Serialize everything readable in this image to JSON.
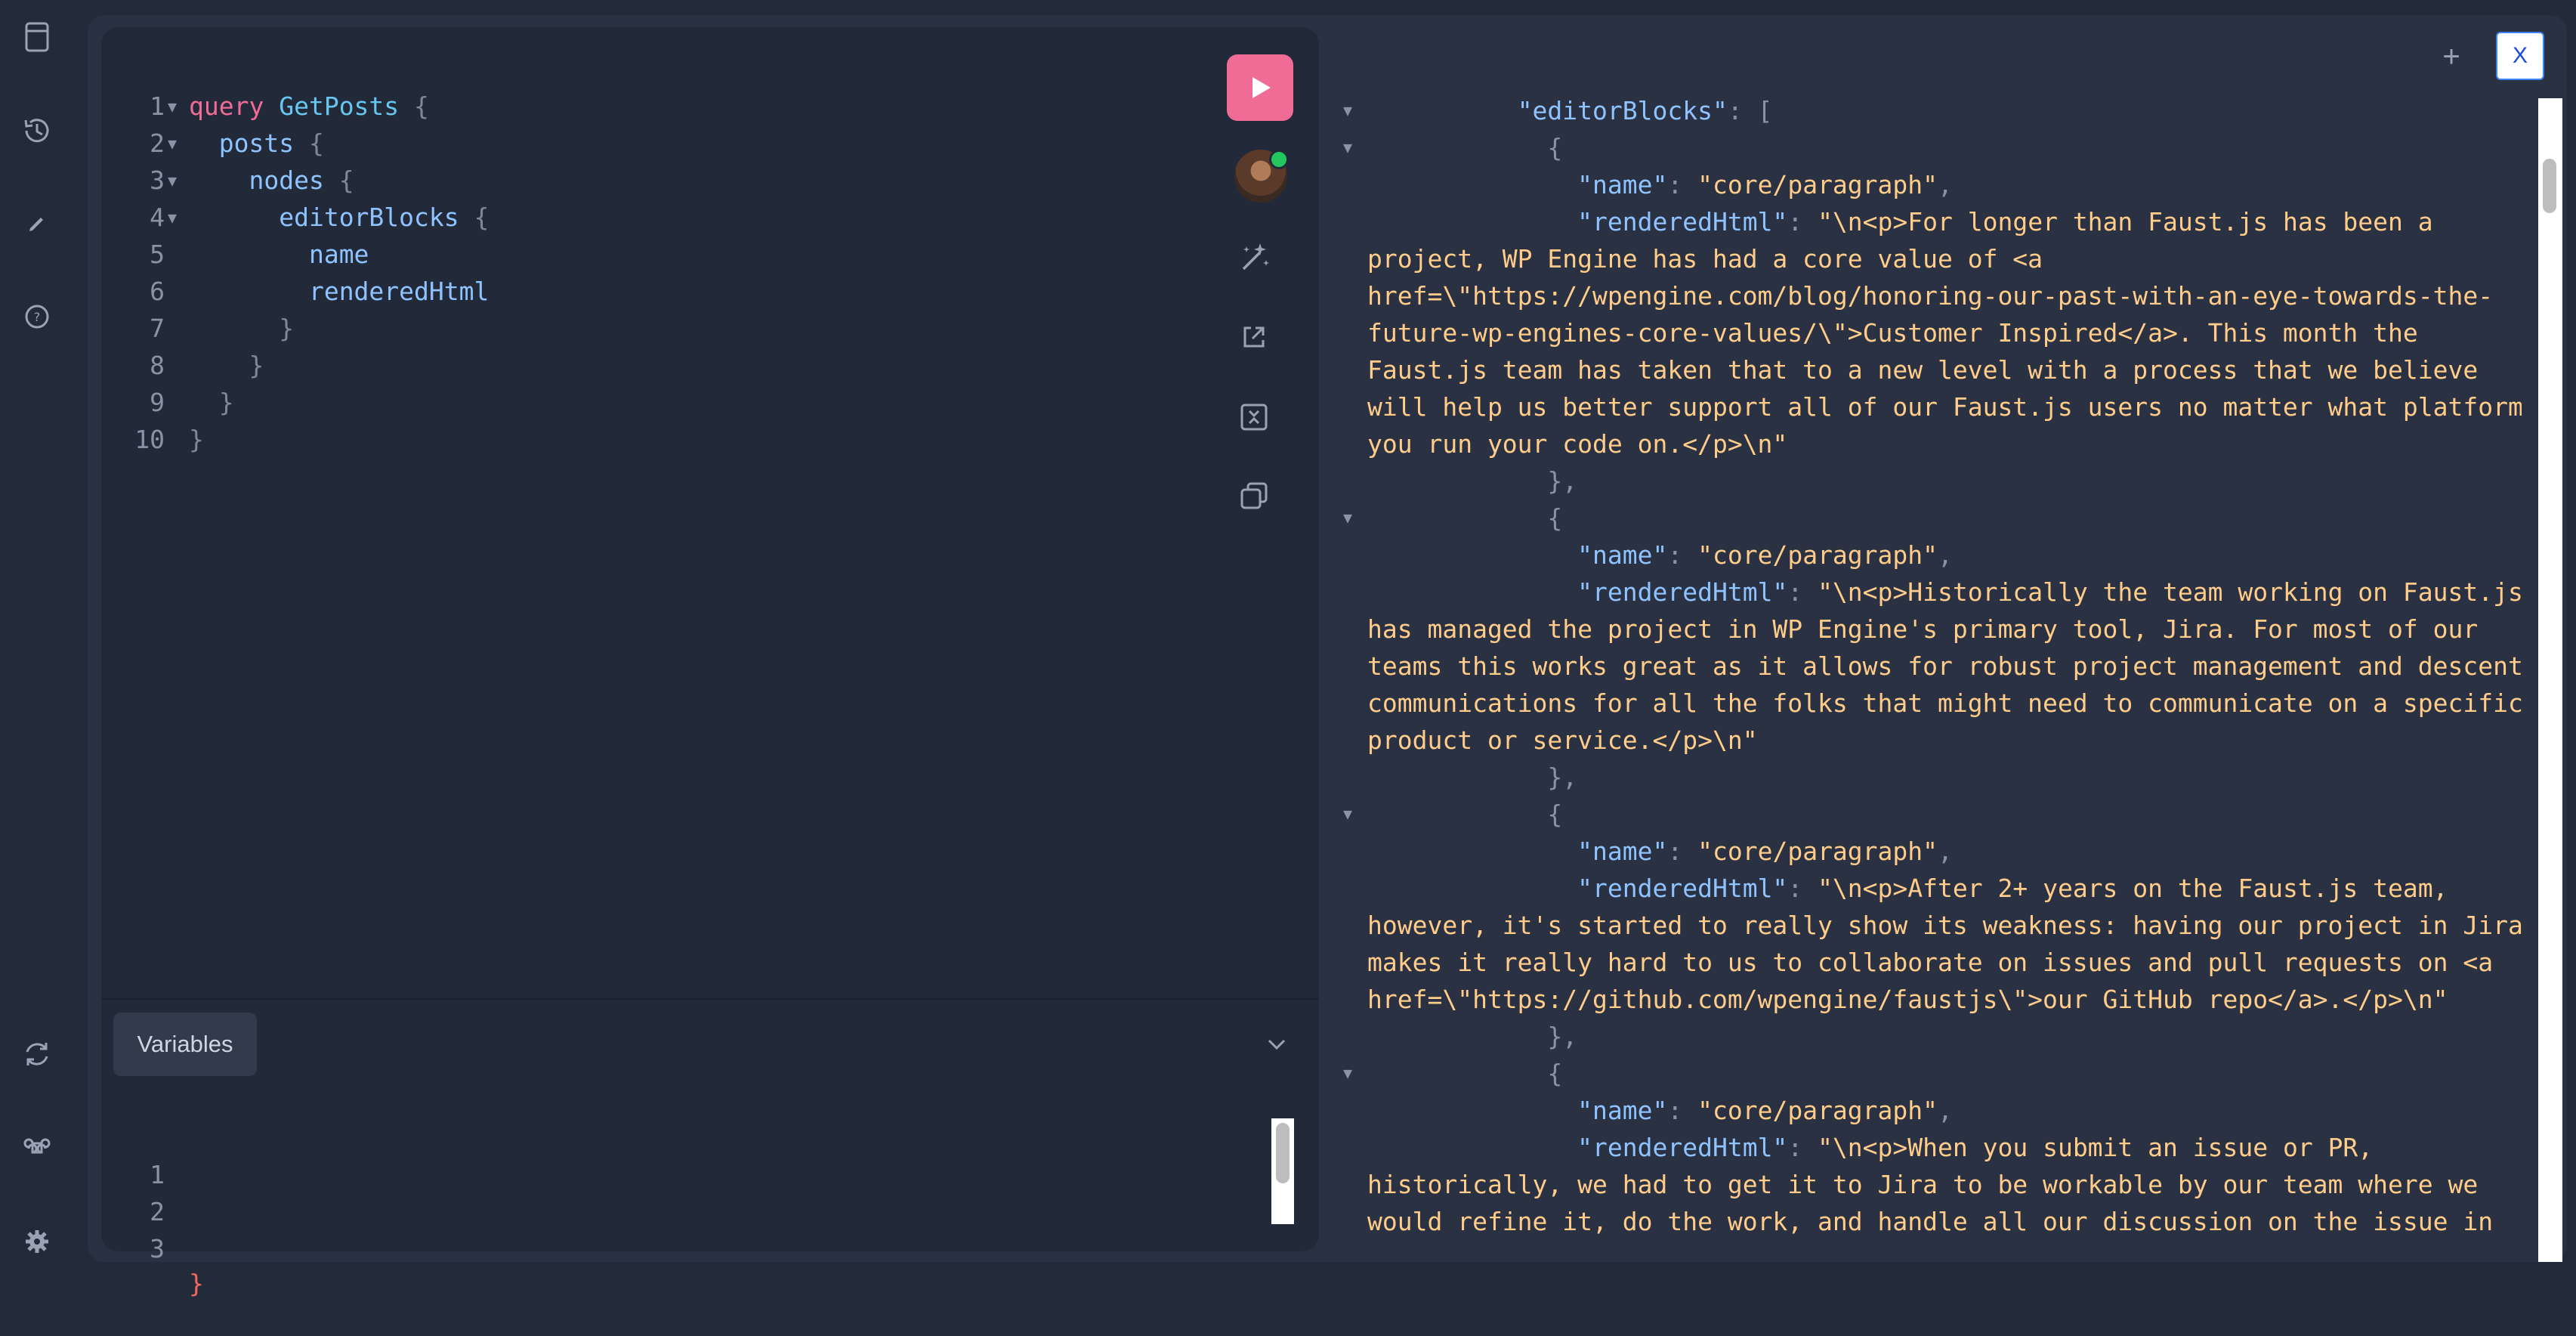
{
  "sidebar": {
    "icons": [
      "docs-icon",
      "history-icon",
      "edit-icon",
      "help-icon",
      "refresh-icon",
      "command-icon",
      "settings-icon"
    ]
  },
  "editor": {
    "lines": [
      {
        "n": "1",
        "fold": true
      },
      {
        "n": "2",
        "fold": true
      },
      {
        "n": "3",
        "fold": true
      },
      {
        "n": "4",
        "fold": true
      },
      {
        "n": "5",
        "fold": false
      },
      {
        "n": "6",
        "fold": false
      },
      {
        "n": "7",
        "fold": false
      },
      {
        "n": "8",
        "fold": false
      },
      {
        "n": "9",
        "fold": false
      },
      {
        "n": "10",
        "fold": false
      }
    ],
    "tokens": {
      "query_kw": "query",
      "operation": "GetPosts",
      "open": "{",
      "close": "}",
      "posts": "posts",
      "nodes": "nodes",
      "editorBlocks": "editorBlocks",
      "name": "name",
      "renderedHtml": "renderedHtml"
    }
  },
  "toolbar": {
    "run_icon": "play-icon",
    "avatar_status": "online",
    "icons": [
      "prettify-icon",
      "open-external-icon",
      "merge-fragments-icon",
      "copy-icon"
    ]
  },
  "variables": {
    "tab_label": "Variables",
    "lines": [
      "1",
      "2",
      "3"
    ],
    "line3_text": "}"
  },
  "result_controls": {
    "plus_label": "+",
    "close_label": "X"
  },
  "result": {
    "lines": [
      {
        "fold": true,
        "indent": "          ",
        "key": "\"editorBlocks\"",
        "punc": ": [",
        "val": ""
      },
      {
        "fold": true,
        "indent": "            ",
        "key": "",
        "punc": "{",
        "val": ""
      },
      {
        "fold": false,
        "indent": "              ",
        "key": "\"name\"",
        "punc": ": ",
        "val": "\"core/paragraph\"",
        "tail": ","
      },
      {
        "fold": false,
        "indent": "              ",
        "key": "\"renderedHtml\"",
        "punc": ": ",
        "val": "\"\\n<p>For longer than Faust.js has been a"
      },
      {
        "fold": false,
        "indent": "",
        "key": "",
        "punc": "",
        "val": "project, WP Engine has had a core value of <a"
      },
      {
        "fold": false,
        "indent": "",
        "key": "",
        "punc": "",
        "val": "href=\\\"https://wpengine.com/blog/honoring-our-past-with-an-eye-towards-the-"
      },
      {
        "fold": false,
        "indent": "",
        "key": "",
        "punc": "",
        "val": "future-wp-engines-core-values/\\\">Customer Inspired</a>. This month the"
      },
      {
        "fold": false,
        "indent": "",
        "key": "",
        "punc": "",
        "val": "Faust.js team has taken that to a new level with a process that we believe"
      },
      {
        "fold": false,
        "indent": "",
        "key": "",
        "punc": "",
        "val": "will help us better support all of our Faust.js users no matter what platform"
      },
      {
        "fold": false,
        "indent": "",
        "key": "",
        "punc": "",
        "val": "you run your code on.</p>\\n\""
      },
      {
        "fold": false,
        "indent": "            ",
        "key": "",
        "punc": "},",
        "val": ""
      },
      {
        "fold": true,
        "indent": "            ",
        "key": "",
        "punc": "{",
        "val": ""
      },
      {
        "fold": false,
        "indent": "              ",
        "key": "\"name\"",
        "punc": ": ",
        "val": "\"core/paragraph\"",
        "tail": ","
      },
      {
        "fold": false,
        "indent": "              ",
        "key": "\"renderedHtml\"",
        "punc": ": ",
        "val": "\"\\n<p>Historically the team working on Faust.js"
      },
      {
        "fold": false,
        "indent": "",
        "key": "",
        "punc": "",
        "val": "has managed the project in WP Engine's primary tool, Jira. For most of our"
      },
      {
        "fold": false,
        "indent": "",
        "key": "",
        "punc": "",
        "val": "teams this works great as it allows for robust project management and descent"
      },
      {
        "fold": false,
        "indent": "",
        "key": "",
        "punc": "",
        "val": "communications for all the folks that might need to communicate on a specific"
      },
      {
        "fold": false,
        "indent": "",
        "key": "",
        "punc": "",
        "val": "product or service.</p>\\n\""
      },
      {
        "fold": false,
        "indent": "            ",
        "key": "",
        "punc": "},",
        "val": ""
      },
      {
        "fold": true,
        "indent": "            ",
        "key": "",
        "punc": "{",
        "val": ""
      },
      {
        "fold": false,
        "indent": "              ",
        "key": "\"name\"",
        "punc": ": ",
        "val": "\"core/paragraph\"",
        "tail": ","
      },
      {
        "fold": false,
        "indent": "              ",
        "key": "\"renderedHtml\"",
        "punc": ": ",
        "val": "\"\\n<p>After 2+ years on the Faust.js team,"
      },
      {
        "fold": false,
        "indent": "",
        "key": "",
        "punc": "",
        "val": "however, it's started to really show its weakness: having our project in Jira"
      },
      {
        "fold": false,
        "indent": "",
        "key": "",
        "punc": "",
        "val": "makes it really hard to us to collaborate on issues and pull requests on <a"
      },
      {
        "fold": false,
        "indent": "",
        "key": "",
        "punc": "",
        "val": "href=\\\"https://github.com/wpengine/faustjs\\\">our GitHub repo</a>.</p>\\n\""
      },
      {
        "fold": false,
        "indent": "            ",
        "key": "",
        "punc": "},",
        "val": ""
      },
      {
        "fold": true,
        "indent": "            ",
        "key": "",
        "punc": "{",
        "val": ""
      },
      {
        "fold": false,
        "indent": "              ",
        "key": "\"name\"",
        "punc": ": ",
        "val": "\"core/paragraph\"",
        "tail": ","
      },
      {
        "fold": false,
        "indent": "              ",
        "key": "\"renderedHtml\"",
        "punc": ": ",
        "val": "\"\\n<p>When you submit an issue or PR,"
      },
      {
        "fold": false,
        "indent": "",
        "key": "",
        "punc": "",
        "val": "historically, we had to get it to Jira to be workable by our team where we"
      },
      {
        "fold": false,
        "indent": "",
        "key": "",
        "punc": "",
        "val": "would refine it, do the work, and handle all our discussion on the issue in"
      }
    ]
  }
}
